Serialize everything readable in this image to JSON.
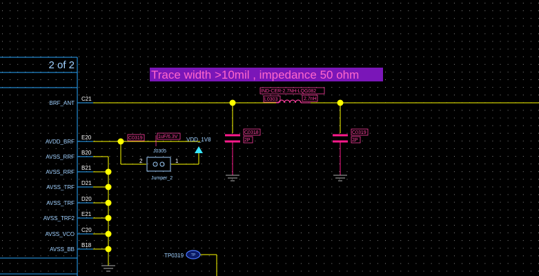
{
  "colors": {
    "background": "#000000",
    "grid_dot": "#8a8a8a",
    "wire": "#ffff00",
    "symbol_outline": "#2aa8ff",
    "pin_label": "#9fd0ff",
    "pin_number": "#ffffff",
    "component": "#ff3fa0",
    "capacitor": "#ff1a8c",
    "junction": "#ffff00",
    "title_bg": "#7a16b8",
    "title_text": "#ff66cc",
    "ground": "#b0b0b0",
    "power_arrow": "#39e6ff",
    "testpoint": "#4a78ff"
  },
  "schematic": {
    "sheet_index": "2 of 2",
    "note": "Trace width >10mil , impedance 50 ohm",
    "pins": [
      {
        "name": "BRF_ANT",
        "number": "C21"
      },
      {
        "name": "AVDD_BRF",
        "number": "E20"
      },
      {
        "name": "AVSS_RRF",
        "number": "B20"
      },
      {
        "name": "AVSS_RRF",
        "number": "B21"
      },
      {
        "name": "AVSS_TRF",
        "number": "D21"
      },
      {
        "name": "AVSS_TRF",
        "number": "D20"
      },
      {
        "name": "AVSS_TRF2",
        "number": "E21"
      },
      {
        "name": "AVSS_VCO",
        "number": "C20"
      },
      {
        "name": "AVSS_BB",
        "number": "B18"
      }
    ],
    "inductor": {
      "part": "IND-CER-2.7NH-LQG082",
      "ref": "L0303",
      "value": "2.7nH"
    },
    "cap_left": {
      "ref": "C0318",
      "value": "2P"
    },
    "cap_right": {
      "ref": "C0319",
      "value": "2P"
    },
    "jumper": {
      "ref": "J0305",
      "label": "Jumper_2",
      "pin1": "1",
      "pin2": "2"
    },
    "cap_small": {
      "ref": "C0319",
      "value": "1uF/6.3V"
    },
    "power_net": "VDD_1V8",
    "testpoint": {
      "ref": "TP0319",
      "label": "TP"
    }
  }
}
